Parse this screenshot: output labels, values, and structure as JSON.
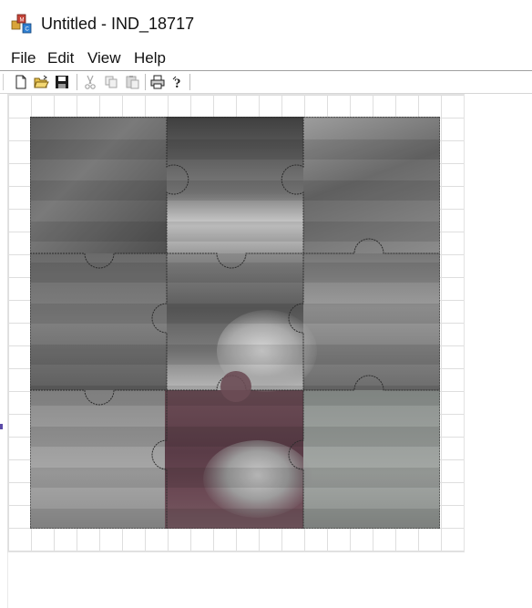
{
  "window": {
    "title": "Untitled - IND_18717",
    "icon": "app-icon-colored-blocks"
  },
  "menu": {
    "items": [
      {
        "label": "File"
      },
      {
        "label": "Edit"
      },
      {
        "label": "View"
      },
      {
        "label": "Help"
      }
    ]
  },
  "toolbar": {
    "buttons": [
      {
        "icon": "new-document-icon",
        "enabled": true
      },
      {
        "icon": "open-folder-icon",
        "enabled": true
      },
      {
        "icon": "save-floppy-icon",
        "enabled": true
      },
      {
        "icon": "cut-scissors-icon",
        "enabled": false
      },
      {
        "icon": "copy-icon",
        "enabled": false
      },
      {
        "icon": "paste-icon",
        "enabled": false
      },
      {
        "icon": "print-icon",
        "enabled": true
      },
      {
        "icon": "help-question-icon",
        "enabled": true
      }
    ]
  },
  "puzzle": {
    "rows": 3,
    "cols": 3,
    "image_description_tone": "grayscale photo with reddish-tinted center-bottom piece"
  },
  "colors": {
    "grid_line": "#dedede",
    "piece_tint_red": "#6b4c55"
  }
}
